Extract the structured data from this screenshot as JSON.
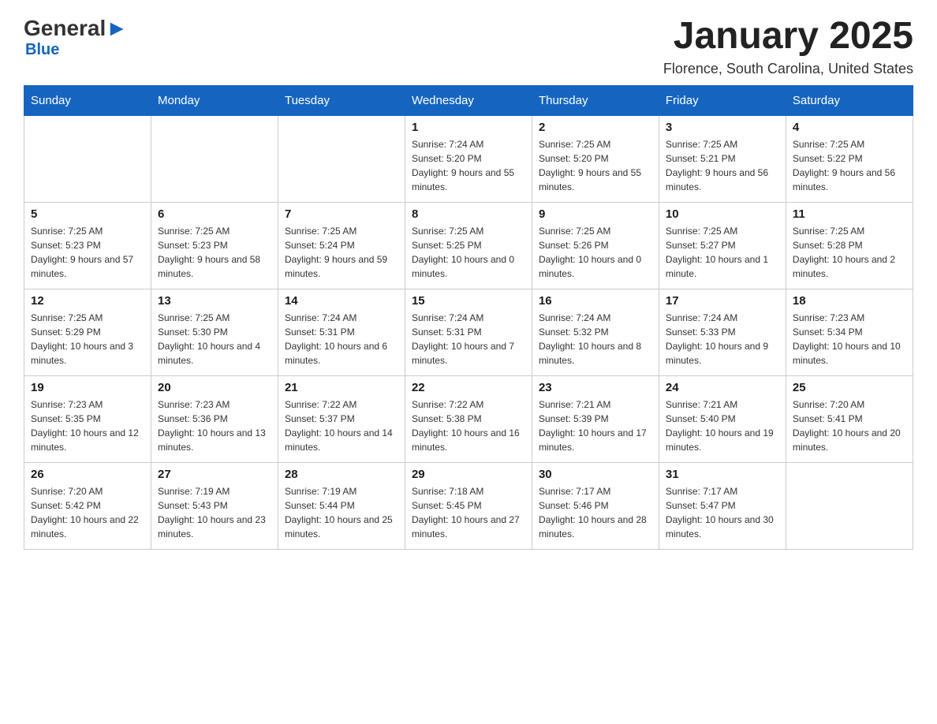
{
  "logo": {
    "general": "General",
    "blue": "Blue",
    "subtitle": "Blue"
  },
  "header": {
    "title": "January 2025",
    "location": "Florence, South Carolina, United States"
  },
  "days_of_week": [
    "Sunday",
    "Monday",
    "Tuesday",
    "Wednesday",
    "Thursday",
    "Friday",
    "Saturday"
  ],
  "weeks": [
    [
      {
        "day": "",
        "info": ""
      },
      {
        "day": "",
        "info": ""
      },
      {
        "day": "",
        "info": ""
      },
      {
        "day": "1",
        "info": "Sunrise: 7:24 AM\nSunset: 5:20 PM\nDaylight: 9 hours and 55 minutes."
      },
      {
        "day": "2",
        "info": "Sunrise: 7:25 AM\nSunset: 5:20 PM\nDaylight: 9 hours and 55 minutes."
      },
      {
        "day": "3",
        "info": "Sunrise: 7:25 AM\nSunset: 5:21 PM\nDaylight: 9 hours and 56 minutes."
      },
      {
        "day": "4",
        "info": "Sunrise: 7:25 AM\nSunset: 5:22 PM\nDaylight: 9 hours and 56 minutes."
      }
    ],
    [
      {
        "day": "5",
        "info": "Sunrise: 7:25 AM\nSunset: 5:23 PM\nDaylight: 9 hours and 57 minutes."
      },
      {
        "day": "6",
        "info": "Sunrise: 7:25 AM\nSunset: 5:23 PM\nDaylight: 9 hours and 58 minutes."
      },
      {
        "day": "7",
        "info": "Sunrise: 7:25 AM\nSunset: 5:24 PM\nDaylight: 9 hours and 59 minutes."
      },
      {
        "day": "8",
        "info": "Sunrise: 7:25 AM\nSunset: 5:25 PM\nDaylight: 10 hours and 0 minutes."
      },
      {
        "day": "9",
        "info": "Sunrise: 7:25 AM\nSunset: 5:26 PM\nDaylight: 10 hours and 0 minutes."
      },
      {
        "day": "10",
        "info": "Sunrise: 7:25 AM\nSunset: 5:27 PM\nDaylight: 10 hours and 1 minute."
      },
      {
        "day": "11",
        "info": "Sunrise: 7:25 AM\nSunset: 5:28 PM\nDaylight: 10 hours and 2 minutes."
      }
    ],
    [
      {
        "day": "12",
        "info": "Sunrise: 7:25 AM\nSunset: 5:29 PM\nDaylight: 10 hours and 3 minutes."
      },
      {
        "day": "13",
        "info": "Sunrise: 7:25 AM\nSunset: 5:30 PM\nDaylight: 10 hours and 4 minutes."
      },
      {
        "day": "14",
        "info": "Sunrise: 7:24 AM\nSunset: 5:31 PM\nDaylight: 10 hours and 6 minutes."
      },
      {
        "day": "15",
        "info": "Sunrise: 7:24 AM\nSunset: 5:31 PM\nDaylight: 10 hours and 7 minutes."
      },
      {
        "day": "16",
        "info": "Sunrise: 7:24 AM\nSunset: 5:32 PM\nDaylight: 10 hours and 8 minutes."
      },
      {
        "day": "17",
        "info": "Sunrise: 7:24 AM\nSunset: 5:33 PM\nDaylight: 10 hours and 9 minutes."
      },
      {
        "day": "18",
        "info": "Sunrise: 7:23 AM\nSunset: 5:34 PM\nDaylight: 10 hours and 10 minutes."
      }
    ],
    [
      {
        "day": "19",
        "info": "Sunrise: 7:23 AM\nSunset: 5:35 PM\nDaylight: 10 hours and 12 minutes."
      },
      {
        "day": "20",
        "info": "Sunrise: 7:23 AM\nSunset: 5:36 PM\nDaylight: 10 hours and 13 minutes."
      },
      {
        "day": "21",
        "info": "Sunrise: 7:22 AM\nSunset: 5:37 PM\nDaylight: 10 hours and 14 minutes."
      },
      {
        "day": "22",
        "info": "Sunrise: 7:22 AM\nSunset: 5:38 PM\nDaylight: 10 hours and 16 minutes."
      },
      {
        "day": "23",
        "info": "Sunrise: 7:21 AM\nSunset: 5:39 PM\nDaylight: 10 hours and 17 minutes."
      },
      {
        "day": "24",
        "info": "Sunrise: 7:21 AM\nSunset: 5:40 PM\nDaylight: 10 hours and 19 minutes."
      },
      {
        "day": "25",
        "info": "Sunrise: 7:20 AM\nSunset: 5:41 PM\nDaylight: 10 hours and 20 minutes."
      }
    ],
    [
      {
        "day": "26",
        "info": "Sunrise: 7:20 AM\nSunset: 5:42 PM\nDaylight: 10 hours and 22 minutes."
      },
      {
        "day": "27",
        "info": "Sunrise: 7:19 AM\nSunset: 5:43 PM\nDaylight: 10 hours and 23 minutes."
      },
      {
        "day": "28",
        "info": "Sunrise: 7:19 AM\nSunset: 5:44 PM\nDaylight: 10 hours and 25 minutes."
      },
      {
        "day": "29",
        "info": "Sunrise: 7:18 AM\nSunset: 5:45 PM\nDaylight: 10 hours and 27 minutes."
      },
      {
        "day": "30",
        "info": "Sunrise: 7:17 AM\nSunset: 5:46 PM\nDaylight: 10 hours and 28 minutes."
      },
      {
        "day": "31",
        "info": "Sunrise: 7:17 AM\nSunset: 5:47 PM\nDaylight: 10 hours and 30 minutes."
      },
      {
        "day": "",
        "info": ""
      }
    ]
  ]
}
